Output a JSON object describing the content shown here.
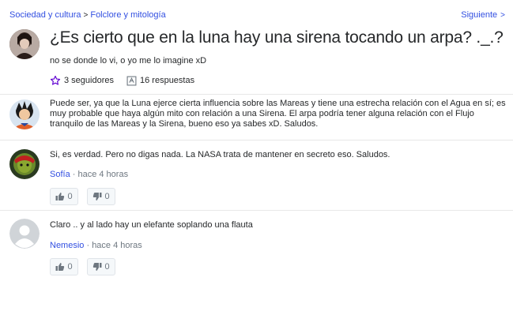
{
  "breadcrumb": {
    "items": [
      "Sociedad y cultura",
      "Folclore y mitología"
    ],
    "next_label": "Siguiente"
  },
  "question": {
    "title": "¿Es cierto que en la luna hay una sirena tocando un arpa? ._.?",
    "body": "no se donde lo vi, o yo me lo imagine xD",
    "followers": "3 seguidores",
    "answers_count": "16 respuestas"
  },
  "answers": [
    {
      "text": "Puede ser, ya que la Luna ejerce cierta influencia sobre las Mareas y tiene una estrecha relación con el Agua en sí; es muy probable que haya algún mito con relación a una Sirena. El arpa podría tener alguna relación con el Flujo tranquilo de las Mareas y la Sirena, bueno eso ya sabes xD. Saludos."
    },
    {
      "text": "Si, es verdad. Pero no digas nada. La NASA trata de mantener en secreto eso. Saludos.",
      "author": "Sofía",
      "time": "· hace 4 horas",
      "up": "0",
      "down": "0"
    },
    {
      "text": "Claro .. y al lado hay un elefante soplando una flauta",
      "author": "Nemesio",
      "time": "· hace 4 horas",
      "up": "0",
      "down": "0"
    }
  ],
  "icons": {
    "chevron": "chevron-right-icon",
    "star": "star-outline-icon",
    "answers": "answers-icon",
    "thumbs_up": "thumbs-up-icon",
    "thumbs_down": "thumbs-down-icon"
  },
  "colors": {
    "link": "#324fe1",
    "star": "#6001d2",
    "text": "#26282a",
    "muted": "#6e7780"
  }
}
